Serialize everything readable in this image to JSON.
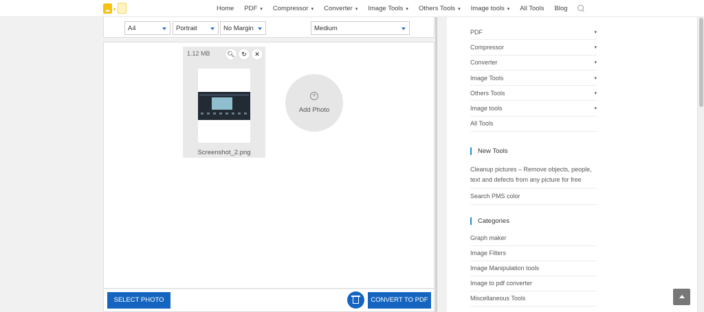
{
  "nav": {
    "items": [
      {
        "label": "Home",
        "dropdown": false
      },
      {
        "label": "PDF",
        "dropdown": true
      },
      {
        "label": "Compressor",
        "dropdown": true
      },
      {
        "label": "Converter",
        "dropdown": true
      },
      {
        "label": "Image Tools",
        "dropdown": true
      },
      {
        "label": "Others Tools",
        "dropdown": true
      },
      {
        "label": "Image tools",
        "dropdown": true
      },
      {
        "label": "All Tools",
        "dropdown": false
      },
      {
        "label": "Blog",
        "dropdown": false
      }
    ]
  },
  "options": {
    "page_size": "A4",
    "orientation": "Portrait",
    "margin": "No Margin",
    "quality": "Medium"
  },
  "image": {
    "size": "1.12 MB",
    "filename": "Screenshot_2.png"
  },
  "add_photo": "Add Photo",
  "buttons": {
    "select": "SELECT PHOTO",
    "convert": "CONVERT TO PDF"
  },
  "sidebar": {
    "menu": [
      {
        "label": "PDF",
        "dropdown": true
      },
      {
        "label": "Compressor",
        "dropdown": true
      },
      {
        "label": "Converter",
        "dropdown": true
      },
      {
        "label": "Image Tools",
        "dropdown": true
      },
      {
        "label": "Others Tools",
        "dropdown": true
      },
      {
        "label": "Image tools",
        "dropdown": true
      },
      {
        "label": "All Tools",
        "dropdown": false
      }
    ],
    "new_tools_title": "New Tools",
    "new_tools": [
      "Cleanup pictures – Remove objects, people, text and defects from any picture for free",
      "Search PMS color"
    ],
    "categories_title": "Categories",
    "categories": [
      "Graph maker",
      "Image Filters",
      "Image Manipulation tools",
      "Image to pdf converter",
      "Miscellaneous Tools"
    ]
  },
  "colors": {
    "accent": "#1565c0",
    "sidebar_marker": "#1e8ccf"
  }
}
